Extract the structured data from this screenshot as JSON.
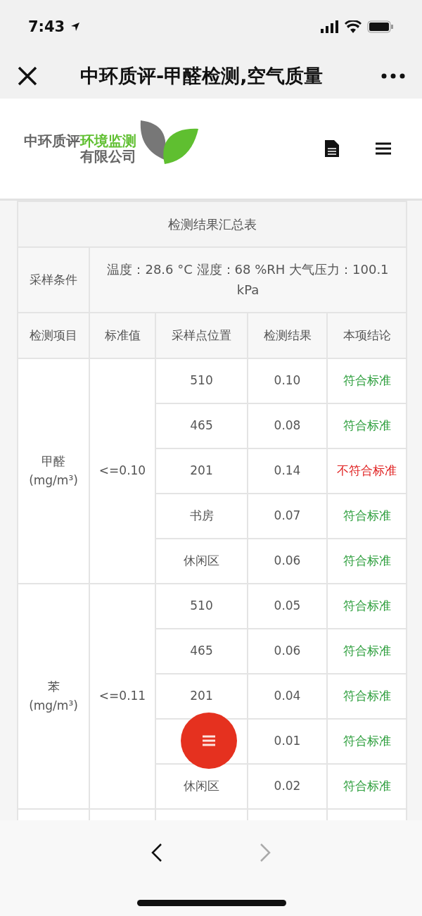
{
  "status_bar": {
    "time": "7:43"
  },
  "nav_bar": {
    "title": "中环质评-甲醛检测,空气质量"
  },
  "header": {
    "logo": {
      "name": "中环质评",
      "highlight": "环境监测",
      "suffix": "有限公司"
    }
  },
  "table": {
    "title": "检测结果汇总表",
    "conditions": {
      "label": "采样条件",
      "value": "温度：28.6 °C   湿度：68 %RH   大气压力：100.1 kPa"
    },
    "columns": [
      "检测项目",
      "标准值",
      "采样点位置",
      "检测结果",
      "本项结论"
    ],
    "groups": [
      {
        "item": "甲醛",
        "unit": "(mg/m³)",
        "standard": "<=0.10",
        "rows": [
          {
            "location": "510",
            "result": "0.10",
            "conclusion": "符合标准",
            "compliant": true
          },
          {
            "location": "465",
            "result": "0.08",
            "conclusion": "符合标准",
            "compliant": true
          },
          {
            "location": "201",
            "result": "0.14",
            "conclusion": "不符合标准",
            "compliant": false
          },
          {
            "location": "书房",
            "result": "0.07",
            "conclusion": "符合标准",
            "compliant": true
          },
          {
            "location": "休闲区",
            "result": "0.06",
            "conclusion": "符合标准",
            "compliant": true
          }
        ]
      },
      {
        "item": "苯",
        "unit": "(mg/m³)",
        "standard": "<=0.11",
        "rows": [
          {
            "location": "510",
            "result": "0.05",
            "conclusion": "符合标准",
            "compliant": true
          },
          {
            "location": "465",
            "result": "0.06",
            "conclusion": "符合标准",
            "compliant": true
          },
          {
            "location": "201",
            "result": "0.04",
            "conclusion": "符合标准",
            "compliant": true
          },
          {
            "result": "0.01",
            "conclusion": "符合标准",
            "compliant": true
          },
          {
            "location": "休闲区",
            "result": "0.02",
            "conclusion": "符合标准",
            "compliant": true
          }
        ]
      }
    ]
  },
  "toolbar": {
    "back_disabled": false,
    "forward_disabled": true
  }
}
